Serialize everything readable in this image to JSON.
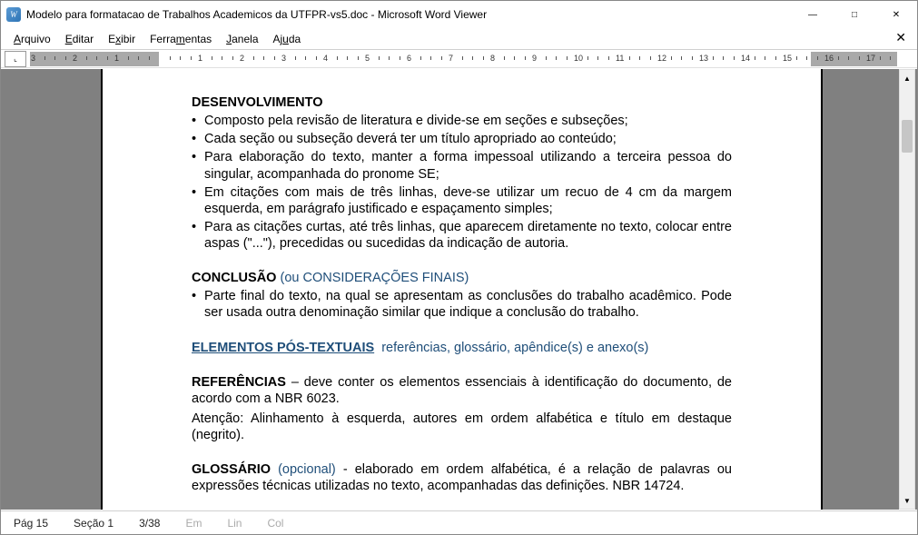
{
  "title": "Modelo para formatacao de Trabalhos Academicos da UTFPR-vs5.doc - Microsoft Word Viewer",
  "icon_letter": "W",
  "menus": {
    "arquivo": {
      "pre": "",
      "u": "A",
      "post": "rquivo"
    },
    "editar": {
      "pre": "",
      "u": "E",
      "post": "ditar"
    },
    "exibir": {
      "pre": "E",
      "u": "x",
      "post": "ibir"
    },
    "ferramentas": {
      "pre": "Ferra",
      "u": "m",
      "post": "entas"
    },
    "janela": {
      "pre": "",
      "u": "J",
      "post": "anela"
    },
    "ajuda": {
      "pre": "Aj",
      "u": "u",
      "post": "da"
    }
  },
  "ruler_numbers": [
    "3",
    "2",
    "1",
    "1",
    "2",
    "3",
    "4",
    "5",
    "6",
    "7",
    "8",
    "9",
    "10",
    "11",
    "12",
    "13",
    "14",
    "15",
    "16",
    "17"
  ],
  "doc": {
    "h_dev": "DESENVOLVIMENTO",
    "b1": "Composto pela revisão de literatura e divide-se em seções e subseções;",
    "b2": "Cada seção ou subseção deverá ter um título apropriado ao conteúdo;",
    "b3": "Para elaboração do texto, manter a forma impessoal utilizando a terceira pessoa do singular, acompanhada do pronome SE;",
    "b4": "Em citações com mais de três linhas, deve-se utilizar um recuo de 4 cm da margem esquerda, em parágrafo justificado e espaçamento simples;",
    "b5": "Para as citações curtas, até três linhas, que aparecem diretamente no texto, colocar entre aspas (\"...\"), precedidas ou sucedidas da indicação de autoria.",
    "h_conc": "CONCLUSÃO",
    "h_conc_sub": "(ou CONSIDERAÇÕES FINAIS)",
    "c1": "Parte final do texto, na qual se apresentam as conclusões do trabalho acadêmico. Pode ser usada outra denominação similar que indique a conclusão do trabalho.",
    "h_post": "ELEMENTOS PÓS-TEXTUAIS",
    "h_post_sub": "referências, glossário, apêndice(s) e anexo(s)",
    "ref_bold": "REFERÊNCIAS",
    "ref_txt": " – deve conter os elementos essenciais à identificação do documento, de acordo com a NBR 6023.",
    "ref_att": "Atenção: Alinhamento à esquerda, autores em ordem alfabética e título em destaque (negrito).",
    "glos_bold": "GLOSSÁRIO",
    "glos_sub": "(opcional)",
    "glos_txt": " - elaborado em ordem alfabética, é a relação de palavras ou expressões técnicas utilizadas no texto, acompanhadas das definições. NBR 14724."
  },
  "status": {
    "page": "Pág 15",
    "section": "Seção 1",
    "prog": "3/38",
    "em": "Em",
    "lin": "Lin",
    "col": "Col"
  }
}
